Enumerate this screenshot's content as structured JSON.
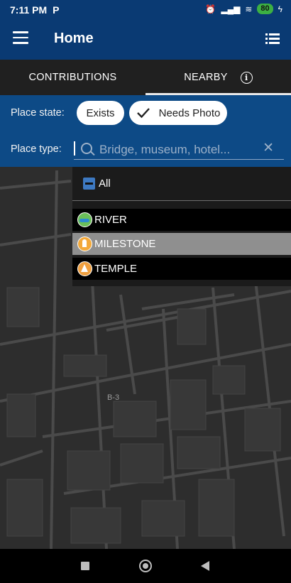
{
  "status_bar": {
    "time": "7:11 PM",
    "app_indicator": "P",
    "battery": "80",
    "icons": [
      "alarm-off-icon",
      "volte-icon",
      "signal-icon",
      "wifi-icon",
      "battery-icon",
      "charging-icon"
    ]
  },
  "app_bar": {
    "title": "Home",
    "menu_icon": "hamburger-menu-icon",
    "action_icon": "list-icon"
  },
  "tabs": [
    {
      "label": "CONTRIBUTIONS",
      "active": false
    },
    {
      "label": "NEARBY",
      "active": true,
      "icon": "info-icon"
    }
  ],
  "filters": {
    "place_state_label": "Place state:",
    "chips": [
      {
        "label": "Exists",
        "checked": false
      },
      {
        "label": "Needs Photo",
        "checked": true
      }
    ],
    "place_type_label": "Place type:",
    "search_placeholder": "Bridge, museum, hotel...",
    "search_value": ""
  },
  "dropdown": {
    "all_label": "All",
    "items": [
      {
        "label": "RIVER",
        "icon": "river-icon",
        "selected": false
      },
      {
        "label": "MILESTONE",
        "icon": "milestone-icon",
        "selected": true
      },
      {
        "label": "TEMPLE",
        "icon": "temple-icon",
        "selected": false
      }
    ]
  },
  "map": {
    "label": "B-3"
  },
  "colors": {
    "primary": "#0a3a73",
    "filter_bg": "#0d4a86",
    "tab_bg": "#202020",
    "map_bg": "#2d2d2d",
    "checkbox": "#3d79c2",
    "battery": "#3cb043"
  },
  "nav_bar": {
    "icons": [
      "recents-square-icon",
      "home-circle-icon",
      "back-triangle-icon"
    ]
  }
}
